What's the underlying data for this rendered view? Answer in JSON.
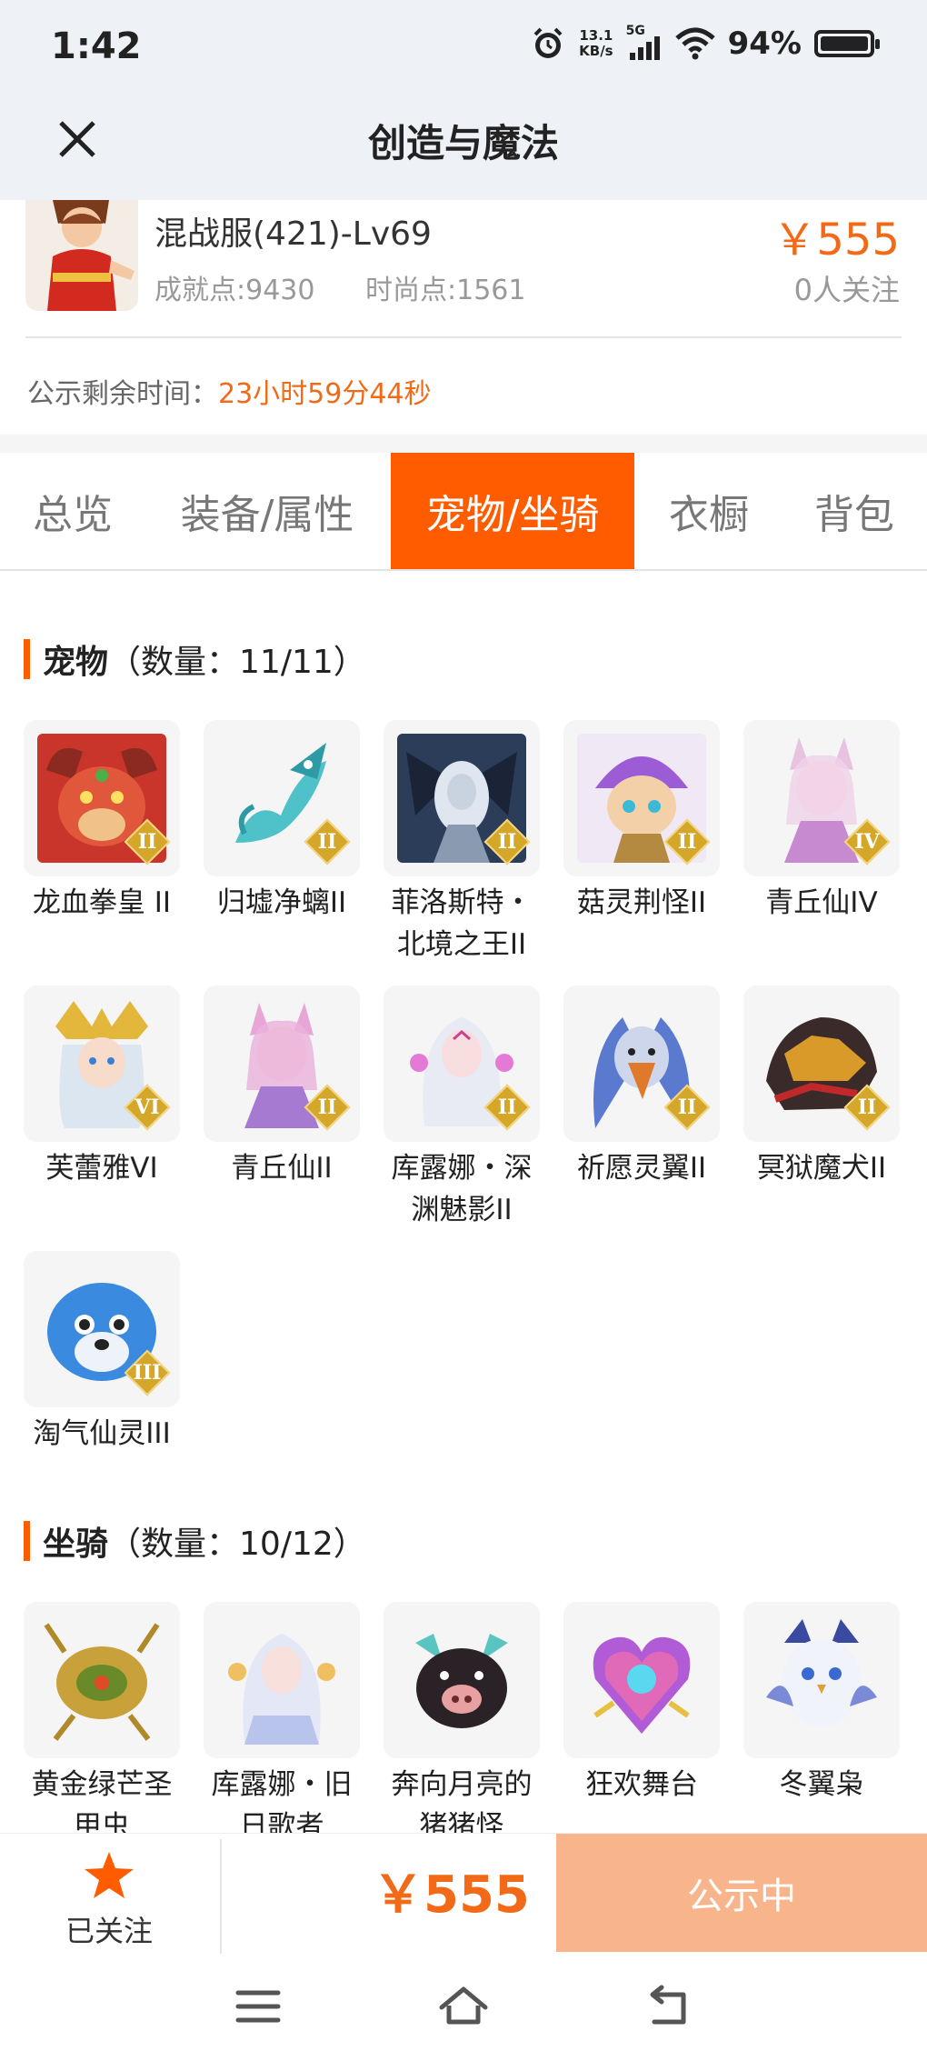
{
  "status_bar": {
    "time": "1:42",
    "net_speed_value": "13.1",
    "net_speed_unit": "KB/s",
    "network": "5G",
    "battery": "94%"
  },
  "nav": {
    "title": "创造与魔法"
  },
  "listing": {
    "server_name": "混战服(421)-Lv69",
    "achievement": "成就点:9430",
    "fashion": "时尚点:1561",
    "price": "￥555",
    "followers": "0人关注",
    "remaining_label": "公示剩余时间：",
    "remaining_value": "23小时59分44秒"
  },
  "tabs": [
    {
      "label": "总览",
      "active": false
    },
    {
      "label": "装备/属性",
      "active": false
    },
    {
      "label": "宠物/坐骑",
      "active": true
    },
    {
      "label": "衣橱",
      "active": false
    },
    {
      "label": "背包",
      "active": false
    }
  ],
  "pets": {
    "title": "宠物",
    "count": "（数量：11/11）",
    "items": [
      {
        "name": "龙血拳皇 II",
        "rank": "II"
      },
      {
        "name": "归墟净螭II",
        "rank": "II"
      },
      {
        "name": "菲洛斯特・北境之王II",
        "rank": "II"
      },
      {
        "name": "菇灵荆怪II",
        "rank": "II"
      },
      {
        "name": "青丘仙IV",
        "rank": "IV"
      },
      {
        "name": "芙蕾雅VI",
        "rank": "VI"
      },
      {
        "name": "青丘仙II",
        "rank": "II"
      },
      {
        "name": "库露娜・深渊魅影II",
        "rank": "II"
      },
      {
        "name": "祈愿灵翼II",
        "rank": "II"
      },
      {
        "name": "冥狱魔犬II",
        "rank": "II"
      },
      {
        "name": "淘气仙灵III",
        "rank": "III"
      }
    ]
  },
  "mounts": {
    "title": "坐骑",
    "count": "（数量：10/12）",
    "items": [
      {
        "name": "黄金绿芒圣甲虫"
      },
      {
        "name": "库露娜・旧日歌者"
      },
      {
        "name": "奔向月亮的猪猪怪"
      },
      {
        "name": "狂欢舞台"
      },
      {
        "name": "冬翼枭"
      }
    ]
  },
  "action_bar": {
    "follow_label": "已关注",
    "price": "￥555",
    "status_button": "公示中"
  },
  "colors": {
    "accent": "#ff5c00",
    "price": "#f26a17",
    "button_disabled": "#f8b58b",
    "header_bg": "#eef2f7"
  }
}
